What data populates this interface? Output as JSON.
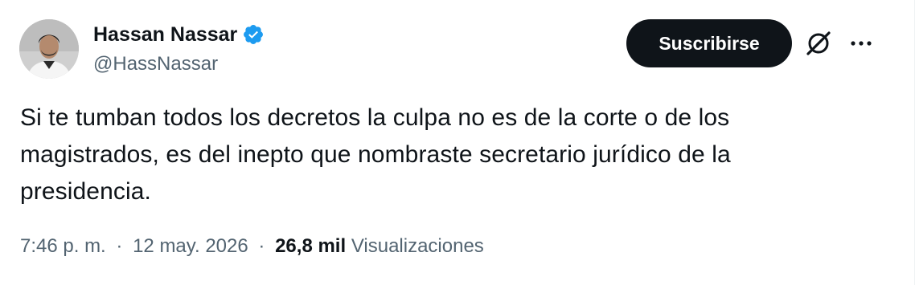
{
  "author": {
    "display_name": "Hassan Nassar",
    "handle": "@HassNassar",
    "verified": true,
    "avatar_icon": "person-avatar"
  },
  "actions": {
    "subscribe_label": "Suscribirse",
    "grok_icon": "grok-icon",
    "more_icon": "more-horizontal-icon"
  },
  "tweet": {
    "text_line_1": "Si te tumban todos los decretos la culpa no es de la corte o de los",
    "text_line_2": "magistrados, es del inepto que nombraste secretario jurídico de la",
    "text_line_3": "presidencia."
  },
  "meta": {
    "time": "7:46 p. m.",
    "separator": "·",
    "date": "12 may. 2026",
    "views_count": "26,8 mil",
    "views_label": "Visualizaciones"
  },
  "colors": {
    "text_primary": "#0f1419",
    "text_secondary": "#536471",
    "verified_blue": "#1d9bf0",
    "button_bg": "#0f1419"
  }
}
